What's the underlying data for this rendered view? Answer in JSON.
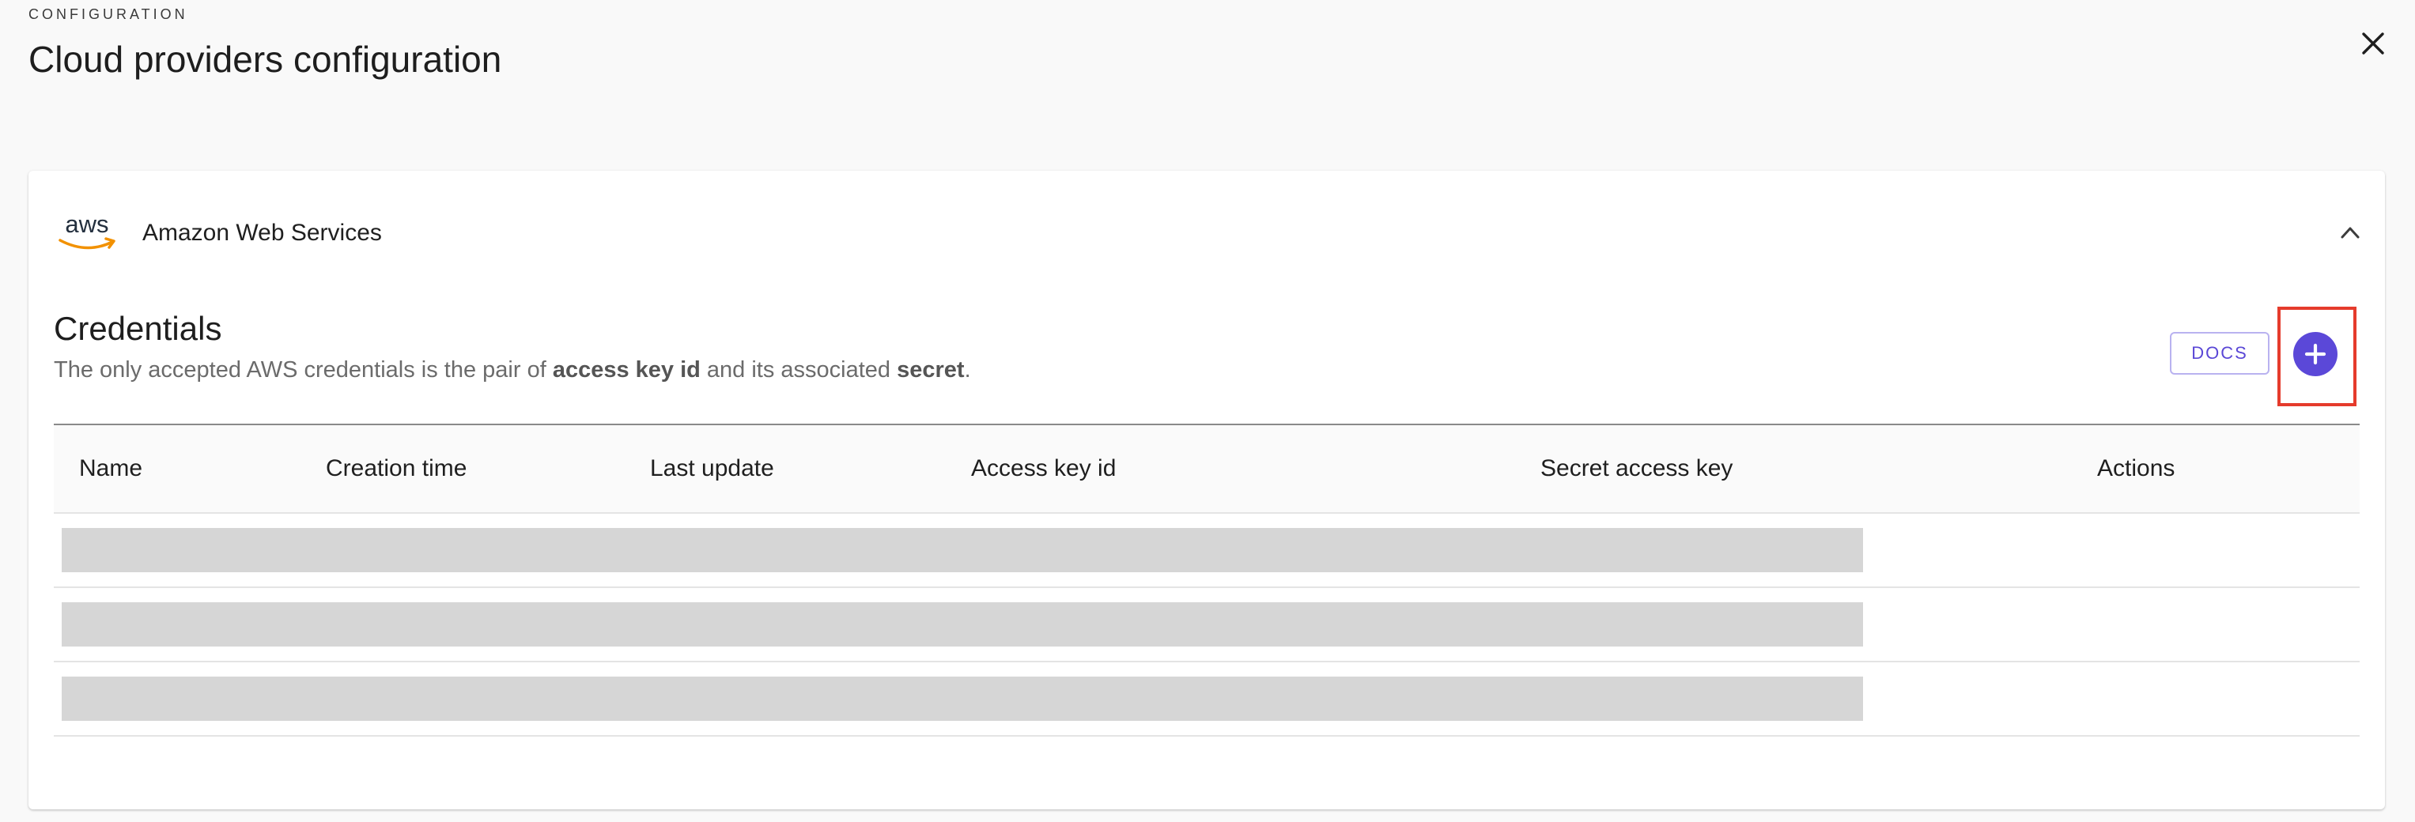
{
  "header": {
    "eyebrow": "CONFIGURATION",
    "title": "Cloud providers configuration",
    "close_icon": "close-icon"
  },
  "provider": {
    "name": "Amazon Web Services",
    "logo_text": "aws",
    "logo_icon": "aws-logo",
    "expand_icon": "chevron-up-icon",
    "brand_color": "#f29100"
  },
  "credentials": {
    "title": "Credentials",
    "description": {
      "part1": "The only accepted AWS credentials is the pair of ",
      "bold1": "access key id",
      "part2": " and its associated ",
      "bold2": "secret",
      "part3": "."
    },
    "docs_label": "DOCS",
    "add_icon": "plus-icon",
    "accent_color": "#5b48d8",
    "highlight_color": "#e53b2c"
  },
  "table": {
    "columns": [
      "Name",
      "Creation time",
      "Last update",
      "Access key id",
      "Secret access key",
      "Actions"
    ],
    "rows_loading": 3
  }
}
